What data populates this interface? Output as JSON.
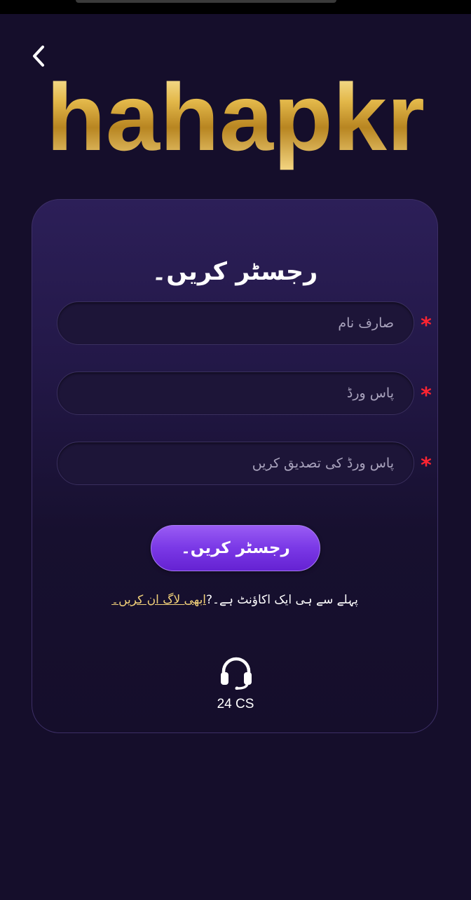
{
  "header": {
    "back_icon": "chevron-left-icon",
    "brand_logo_text": "hahapkr"
  },
  "form": {
    "title": "رجسٹر کریں۔",
    "required_marker": "*",
    "username": {
      "placeholder": "صارف نام",
      "value": ""
    },
    "password": {
      "placeholder": "پاس ورڈ",
      "value": ""
    },
    "confirm_password": {
      "placeholder": "پاس ورڈ کی تصدیق کریں",
      "value": ""
    },
    "submit_label": "رجسٹر کریں۔"
  },
  "login_prompt": {
    "text": "پہلے سے ہی ایک اکاؤنٹ ہے۔?",
    "link_label": "ابھی لاگ ان کریں۔"
  },
  "support": {
    "icon": "headset-icon",
    "label": "24 CS"
  },
  "colors": {
    "background": "#150e2b",
    "card_top": "#2c1f58",
    "accent_purple": "#7a38e6",
    "required_red": "#ff2431",
    "link_gold": "#f3d27a",
    "logo_gold": "#d4a93a"
  }
}
